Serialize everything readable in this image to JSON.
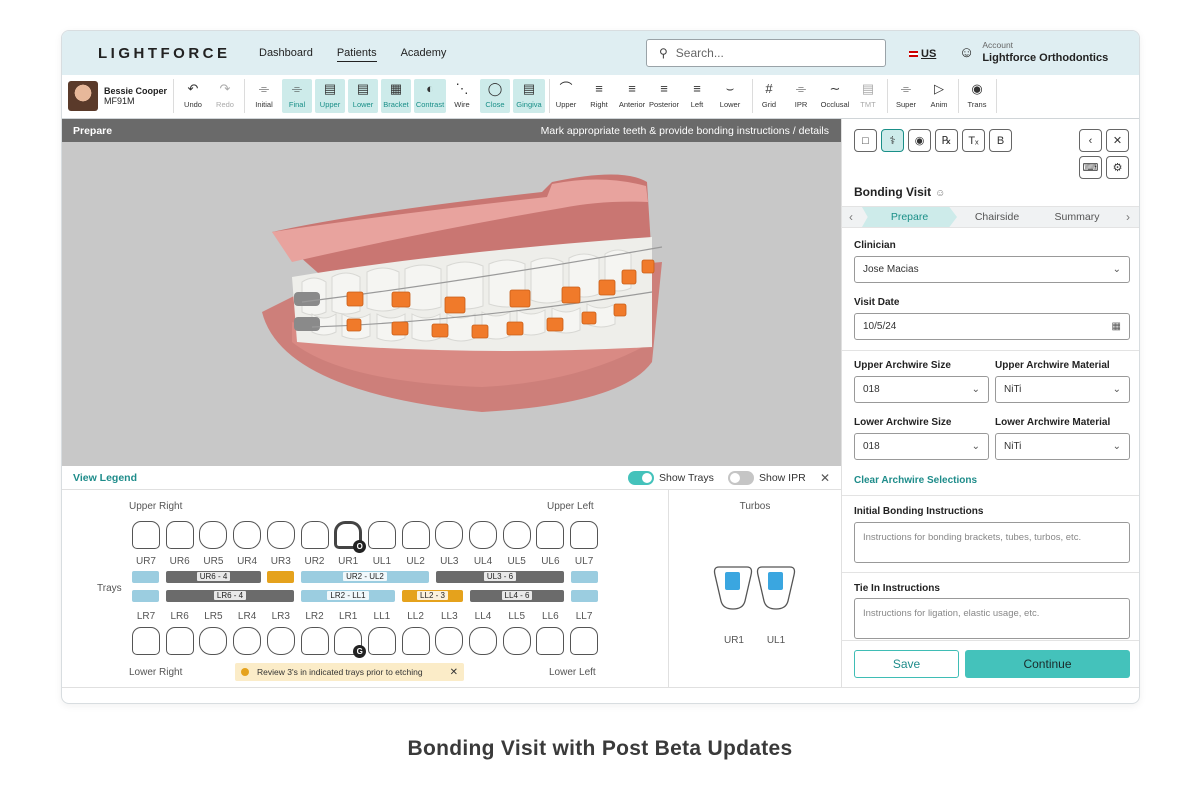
{
  "header": {
    "logo": "LIGHTFORCE",
    "nav": [
      "Dashboard",
      "Patients",
      "Academy"
    ],
    "search_placeholder": "Search...",
    "region": "US",
    "account_label": "Account",
    "account_name": "Lightforce Orthodontics"
  },
  "patient": {
    "name": "Bessie Cooper",
    "id": "MF91M"
  },
  "toolbar": {
    "tools": [
      "Undo",
      "Redo",
      "Initial",
      "Final",
      "Upper",
      "Lower",
      "Bracket",
      "Contrast",
      "Wire",
      "Close",
      "Gingiva",
      "Upper",
      "Right",
      "Anterior",
      "Posterior",
      "Left",
      "Lower",
      "Grid",
      "IPR",
      "Occlusal",
      "TMT",
      "Super",
      "Anim",
      "Trans"
    ],
    "selected": [
      "Final",
      "Upper",
      "Lower",
      "Bracket",
      "Contrast",
      "Close",
      "Gingiva"
    ],
    "disabled": [
      "Redo",
      "TMT"
    ]
  },
  "viewer": {
    "title": "Prepare",
    "instruction": "Mark appropriate teeth & provide bonding instructions / details"
  },
  "legend": {
    "view_legend": "View Legend",
    "show_trays": "Show Trays",
    "show_trays_on": true,
    "show_ipr": "Show IPR",
    "show_ipr_on": false
  },
  "chart": {
    "upper_right": "Upper Right",
    "upper_left": "Upper Left",
    "lower_right": "Lower Right",
    "lower_left": "Lower Left",
    "trays_label": "Trays",
    "upper_labels": [
      "UR7",
      "UR6",
      "UR5",
      "UR4",
      "UR3",
      "UR2",
      "UR1",
      "UL1",
      "UL2",
      "UL3",
      "UL4",
      "UL5",
      "UL6",
      "UL7"
    ],
    "lower_labels": [
      "LR7",
      "LR6",
      "LR5",
      "LR4",
      "LR3",
      "LR2",
      "LR1",
      "LL1",
      "LL2",
      "LL3",
      "LL4",
      "LL5",
      "LL6",
      "LL7"
    ],
    "upper_trays": [
      "UR6 - 4",
      "UR2 - UL2",
      "UL3 - 6"
    ],
    "lower_trays": [
      "LR6 - 4",
      "LR2 - LL1",
      "LL2 - 3",
      "LL4 - 6"
    ],
    "badge_upper": "O",
    "badge_lower": "G",
    "warning": "Review 3's in indicated trays prior to etching"
  },
  "turbos": {
    "title": "Turbos",
    "teeth": [
      "UR1",
      "UL1"
    ]
  },
  "panel": {
    "title": "Bonding Visit",
    "steps": [
      "Prepare",
      "Chairside",
      "Summary"
    ],
    "active_step": "Prepare",
    "clinician_label": "Clinician",
    "clinician_value": "Jose Macias",
    "visit_date_label": "Visit Date",
    "visit_date_value": "10/5/24",
    "upper_size_label": "Upper Archwire Size",
    "upper_size_value": "018",
    "upper_material_label": "Upper Archwire Material",
    "upper_material_value": "NiTi",
    "lower_size_label": "Lower Archwire Size",
    "lower_size_value": "018",
    "lower_material_label": "Lower Archwire Material",
    "lower_material_value": "NiTi",
    "clear_link": "Clear Archwire Selections",
    "initial_label": "Initial Bonding Instructions",
    "initial_placeholder": "Instructions for bonding brackets, tubes, turbos, etc.",
    "tie_label": "Tie In Instructions",
    "tie_placeholder": "Instructions for ligation, elastic usage, etc.",
    "save": "Save",
    "continue": "Continue"
  },
  "caption": "Bonding Visit with Post Beta Updates",
  "colors": {
    "accent": "#44c2bb",
    "accent_dark": "#1e8c8a",
    "tray_blue": "#9bcde0",
    "tray_gray": "#6b6b6b",
    "tray_orange": "#e5a21c",
    "bracket": "#f07a2a",
    "gum": "#d9847e"
  }
}
